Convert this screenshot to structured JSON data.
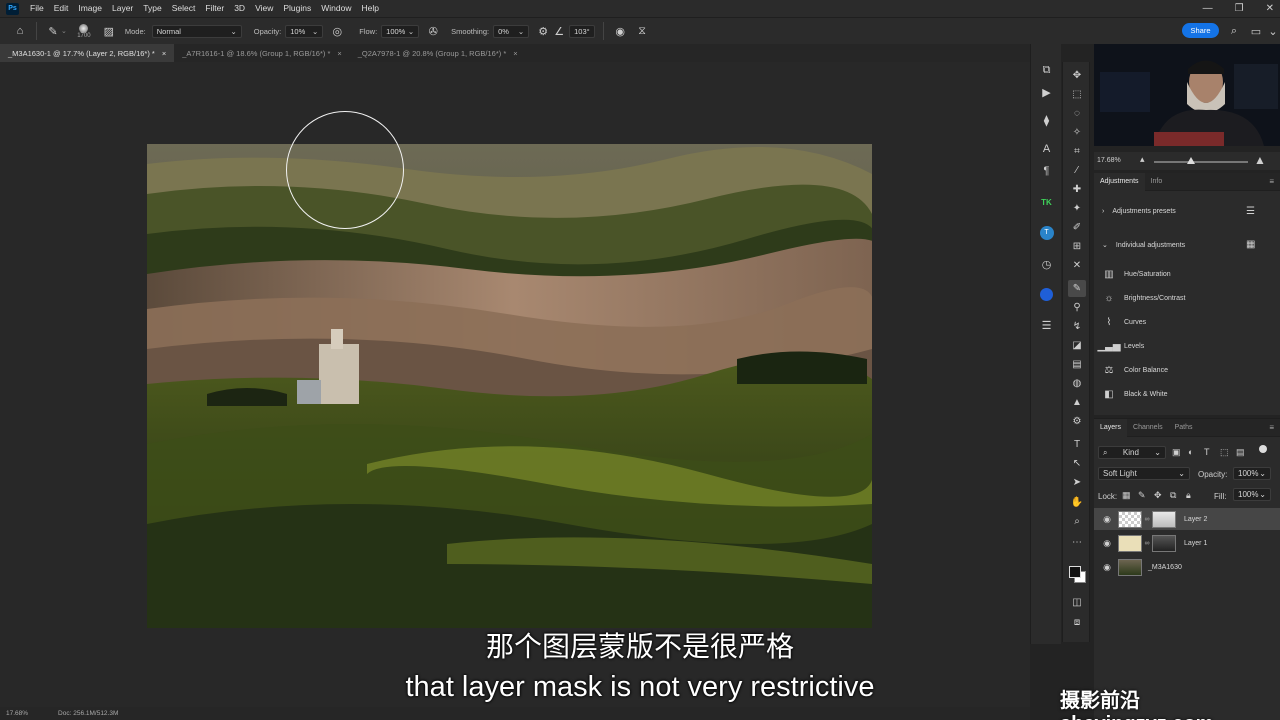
{
  "menu": {
    "logo": "Ps",
    "items": [
      "File",
      "Edit",
      "Image",
      "Layer",
      "Type",
      "Select",
      "Filter",
      "3D",
      "View",
      "Plugins",
      "Window",
      "Help"
    ]
  },
  "window_controls": [
    "—",
    "❐",
    "✕"
  ],
  "options": {
    "brush_size": "1700",
    "mode_label": "Mode:",
    "mode_value": "Normal",
    "opacity_label": "Opacity:",
    "opacity_value": "10%",
    "flow_label": "Flow:",
    "flow_value": "100%",
    "smoothing_label": "Smoothing:",
    "smoothing_value": "0%",
    "angle_value": "103°",
    "share_label": "Share"
  },
  "tabs": [
    {
      "label": "_M3A1630-1 @ 17.7% (Layer 2, RGB/16*) *",
      "close": "×"
    },
    {
      "label": "_A7R1616-1 @ 18.6% (Group 1, RGB/16*) *",
      "close": "×"
    },
    {
      "label": "_Q2A7978-1 @ 20.8% (Group 1, RGB/16*) *",
      "close": "×"
    }
  ],
  "status": {
    "zoom": "17.68%",
    "doc": "Doc: 256.1M/512.3M"
  },
  "subtitles": {
    "zh": "那个图层蒙版不是很严格",
    "en": "that layer mask is not very restrictive"
  },
  "watermark": "摄影前沿 sheyingzyz.com",
  "navigator": {
    "zoom": "17.68%"
  },
  "adjustments": {
    "tabs": [
      "Adjustments",
      "Info"
    ],
    "presets_label": "Adjustments presets",
    "individual_label": "Individual adjustments",
    "items": [
      "Hue/Saturation",
      "Brightness/Contrast",
      "Curves",
      "Levels",
      "Color Balance",
      "Black & White"
    ]
  },
  "layers": {
    "tabs": [
      "Layers",
      "Channels",
      "Paths"
    ],
    "filter_kind": "Kind",
    "blend_mode": "Soft Light",
    "opacity_label": "Opacity:",
    "opacity_value": "100%",
    "lock_label": "Lock:",
    "fill_label": "Fill:",
    "fill_value": "100%",
    "rows": [
      "Layer 2",
      "Layer 1",
      "_M3A1630"
    ]
  },
  "colors": {
    "accent": "#1473e6",
    "panel": "#2b2b2b",
    "canvas": "#282828"
  }
}
